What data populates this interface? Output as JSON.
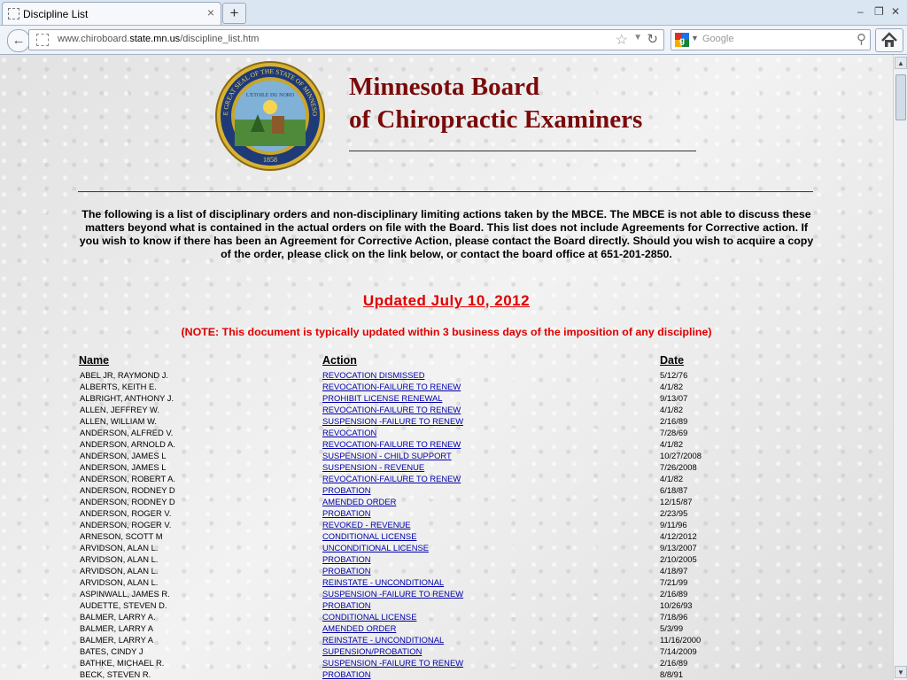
{
  "browser": {
    "tab_title": "Discipline List",
    "new_tab": "+",
    "url_pre": "www.chiroboard.",
    "url_host": "state.mn.us",
    "url_post": "/discipline_list.htm",
    "search_placeholder": "Google",
    "minimize": "–",
    "restore": "❐",
    "close": "✕"
  },
  "header": {
    "board_line1": "Minnesota Board",
    "board_line2": "of Chiropractic Examiners",
    "seal_top_text": "THE GREAT SEAL OF THE STATE OF MINNESOTA",
    "seal_motto": "L'ETOILE DU NORD",
    "seal_year": "1858"
  },
  "intro": "The following is a list of disciplinary orders and non-disciplinary limiting actions taken by the MBCE. The MBCE is not able to discuss these matters beyond what is contained in the actual orders on file with the Board. This list does not include Agreements for Corrective action. If you wish to know if there has been an Agreement for Corrective Action, please contact the Board directly. Should you wish to acquire a copy of the order, please click on the link below, or contact the board office at 651-201-2850.",
  "updated": "Updated July 10, 2012",
  "note": "(NOTE: This document is typically updated within 3 business days of the imposition of any discipline)",
  "columns": {
    "name": "Name",
    "action": "Action",
    "date": "Date"
  },
  "rows": [
    {
      "name": "ABEL JR, RAYMOND J.",
      "action": "REVOCATION DISMISSED",
      "date": "5/12/76"
    },
    {
      "name": "ALBERTS, KEITH E.",
      "action": "REVOCATION-FAILURE TO RENEW",
      "date": "4/1/82"
    },
    {
      "name": "ALBRIGHT, ANTHONY J.",
      "action": "PROHIBIT LICENSE RENEWAL",
      "date": "9/13/07"
    },
    {
      "name": "ALLEN, JEFFREY W.",
      "action": "REVOCATION-FAILURE TO RENEW",
      "date": "4/1/82"
    },
    {
      "name": "ALLEN, WILLIAM W.",
      "action": "SUSPENSION -FAILURE TO RENEW",
      "date": "2/16/89"
    },
    {
      "name": "ANDERSON, ALFRED V.",
      "action": "REVOCATION",
      "date": "7/28/69"
    },
    {
      "name": "ANDERSON, ARNOLD A.",
      "action": "REVOCATION-FAILURE TO RENEW",
      "date": "4/1/82"
    },
    {
      "name": "ANDERSON, JAMES L",
      "action": "SUSPENSION - CHILD SUPPORT",
      "date": "10/27/2008"
    },
    {
      "name": "ANDERSON, JAMES L",
      "action": "SUSPENSION - REVENUE",
      "date": "7/26/2008"
    },
    {
      "name": "ANDERSON, ROBERT A.",
      "action": "REVOCATION-FAILURE TO RENEW",
      "date": "4/1/82"
    },
    {
      "name": "ANDERSON, RODNEY D",
      "action": "PROBATION",
      "date": "6/18/87"
    },
    {
      "name": "ANDERSON, RODNEY D",
      "action": "AMENDED ORDER",
      "date": "12/15/87"
    },
    {
      "name": "ANDERSON, ROGER V.",
      "action": "PROBATION",
      "date": "2/23/95"
    },
    {
      "name": "ANDERSON, ROGER V.",
      "action": "REVOKED - REVENUE",
      "date": "9/11/96"
    },
    {
      "name": "ARNESON, SCOTT M",
      "action": "CONDITIONAL LICENSE",
      "date": "4/12/2012"
    },
    {
      "name": "ARVIDSON, ALAN L.",
      "action": "UNCONDITIONAL LICENSE",
      "date": "9/13/2007"
    },
    {
      "name": "ARVIDSON, ALAN L.",
      "action": "PROBATION",
      "date": "2/10/2005"
    },
    {
      "name": "ARVIDSON, ALAN L.",
      "action": "PROBATION",
      "date": "4/18/97"
    },
    {
      "name": "ARVIDSON, ALAN L.",
      "action": "REINSTATE - UNCONDITIONAL",
      "date": "7/21/99"
    },
    {
      "name": "ASPINWALL, JAMES R.",
      "action": "SUSPENSION -FAILURE TO RENEW",
      "date": "2/16/89"
    },
    {
      "name": "AUDETTE, STEVEN D.",
      "action": "PROBATION",
      "date": "10/26/93"
    },
    {
      "name": "BALMER, LARRY A.",
      "action": "CONDITIONAL LICENSE",
      "date": "7/18/96"
    },
    {
      "name": "BALMER, LARRY A",
      "action": "AMENDED ORDER",
      "date": "5/3/99"
    },
    {
      "name": "BALMER, LARRY A",
      "action": "REINSTATE - UNCONDITIONAL",
      "date": "11/16/2000"
    },
    {
      "name": "BATES, CINDY J",
      "action": "SUPENSION/PROBATION",
      "date": "7/14/2009"
    },
    {
      "name": "BATHKE, MICHAEL R.",
      "action": "SUSPENSION -FAILURE TO RENEW",
      "date": "2/16/89"
    },
    {
      "name": "BECK, STEVEN R.",
      "action": "PROBATION",
      "date": "8/8/91"
    }
  ]
}
